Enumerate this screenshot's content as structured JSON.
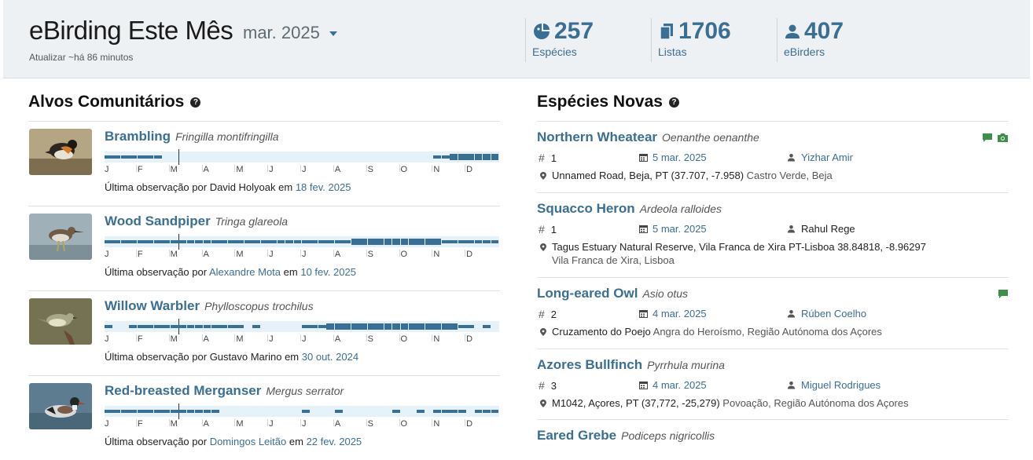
{
  "header": {
    "title": "eBirding Este Mês",
    "month": "mar. 2025",
    "updated": "Atualizar ~há 86 minutos",
    "stats": [
      {
        "value": "257",
        "label": "Espécies",
        "icon": "species-icon"
      },
      {
        "value": "1706",
        "label": "Listas",
        "icon": "checklist-icon"
      },
      {
        "value": "407",
        "label": "eBirders",
        "icon": "person-icon"
      }
    ]
  },
  "targets": {
    "title": "Alvos Comunitários",
    "months": [
      "J",
      "F",
      "M",
      "A",
      "M",
      "J",
      "J",
      "A",
      "S",
      "O",
      "N",
      "D"
    ],
    "items": [
      {
        "name": "Brambling",
        "sci": "Fringilla montifringilla",
        "prefix": "Última observação por",
        "observer": "David Holyoak",
        "observer_link": false,
        "conj": "em",
        "date": "18 fev. 2025",
        "freq": [
          0.3,
          0.3,
          0.35,
          0.2,
          0.25,
          0.2,
          0.3,
          0.0,
          0,
          0,
          0,
          0,
          0,
          0,
          0,
          0,
          0,
          0,
          0,
          0,
          0,
          0,
          0,
          0,
          0,
          0,
          0,
          0,
          0,
          0,
          0,
          0,
          0,
          0,
          0,
          0,
          0,
          0,
          0,
          0,
          0.2,
          0.3,
          0.5,
          0.6,
          0.6,
          0.6,
          0.6,
          0.6
        ]
      },
      {
        "name": "Wood Sandpiper",
        "sci": "Tringa glareola",
        "prefix": "Última observação por",
        "observer": "Alexandre Mota",
        "observer_link": true,
        "conj": "em",
        "date": "10 fev. 2025",
        "freq": [
          0.25,
          0.25,
          0.25,
          0.25,
          0.25,
          0.25,
          0.25,
          0.3,
          0.3,
          0.3,
          0.3,
          0.35,
          0.35,
          0.35,
          0.3,
          0.3,
          0.3,
          0.3,
          0.35,
          0.35,
          0.35,
          0.35,
          0.35,
          0.35,
          0.35,
          0.35,
          0.35,
          0.35,
          0.35,
          0.35,
          0.5,
          0.5,
          0.5,
          0.5,
          0.5,
          0.5,
          0.5,
          0.5,
          0.5,
          0.5,
          0.5,
          0.4,
          0.4,
          0.35,
          0.35,
          0.3,
          0.3,
          0.3
        ]
      },
      {
        "name": "Willow Warbler",
        "sci": "Phylloscopus trochilus",
        "prefix": "Última observação por",
        "observer": "Gustavo Marino",
        "observer_link": false,
        "conj": "em",
        "date": "30 out. 2024",
        "freq": [
          0.2,
          0,
          0,
          0.2,
          0.2,
          0.2,
          0.2,
          0.25,
          0.3,
          0.3,
          0.3,
          0.3,
          0.3,
          0.3,
          0.3,
          0.3,
          0.3,
          0,
          0.3,
          0,
          0,
          0,
          0,
          0,
          0.3,
          0.3,
          0.4,
          0.45,
          0.5,
          0.55,
          0.6,
          0.7,
          0.8,
          0.8,
          0.8,
          0.8,
          0.8,
          0.8,
          0.7,
          0.7,
          0.65,
          0.6,
          0.5,
          0.4,
          0.3,
          0,
          0.2,
          0
        ]
      },
      {
        "name": "Red-breasted Merganser",
        "sci": "Mergus serrator",
        "prefix": "Última observação por",
        "observer": "Domingos Leitão",
        "observer_link": true,
        "conj": "em",
        "date": "22 fev. 2025",
        "freq": [
          0.35,
          0.35,
          0.35,
          0.35,
          0.35,
          0.35,
          0.35,
          0.35,
          0.35,
          0.3,
          0.3,
          0.3,
          0.3,
          0.3,
          0,
          0,
          0,
          0,
          0,
          0,
          0,
          0,
          0,
          0,
          0.3,
          0,
          0,
          0,
          0.3,
          0,
          0,
          0,
          0,
          0,
          0,
          0.3,
          0,
          0,
          0.3,
          0,
          0.3,
          0.3,
          0.35,
          0.35,
          0,
          0.3,
          0.35,
          0.35
        ]
      }
    ]
  },
  "new_species": {
    "title": "Espécies Novas",
    "items": [
      {
        "name": "Northern Wheatear",
        "sci": "Oenanthe oenanthe",
        "num": "1",
        "date": "5 mar. 2025",
        "observer": "Yizhar Amir",
        "observer_link": true,
        "loc": "Unnamed Road, Beja, PT (37.707, -7.958)",
        "loc_sub": "Castro Verde, Beja",
        "loc_line2": "",
        "media": [
          "comment-icon",
          "camera-icon"
        ]
      },
      {
        "name": "Squacco Heron",
        "sci": "Ardeola ralloides",
        "num": "1",
        "date": "5 mar. 2025",
        "observer": "Rahul Rege",
        "observer_link": false,
        "loc": "Tagus Estuary Natural Reserve, Vila Franca de Xira PT-Lisboa 38.84818, -8.96297",
        "loc_sub": "",
        "loc_line2": "Vila Franca de Xira, Lisboa",
        "media": []
      },
      {
        "name": "Long-eared Owl",
        "sci": "Asio otus",
        "num": "2",
        "date": "4 mar. 2025",
        "observer": "Rúben Coelho",
        "observer_link": true,
        "loc": "Cruzamento do Poejo",
        "loc_sub": "Angra do Heroísmo, Região Autónoma dos Açores",
        "loc_line2": "",
        "media": [
          "comment-icon"
        ]
      },
      {
        "name": "Azores Bullfinch",
        "sci": "Pyrrhula murina",
        "num": "3",
        "date": "4 mar. 2025",
        "observer": "Miguel Rodrigues",
        "observer_link": true,
        "loc": "M1042, Açores, PT (37,772, -25,279)",
        "loc_sub": "Povoação, Região Autónoma dos Açores",
        "loc_line2": "",
        "media": []
      },
      {
        "name": "Eared Grebe",
        "sci": "Podiceps nigricollis",
        "num": "",
        "date": "",
        "observer": "",
        "observer_link": false,
        "loc": "",
        "loc_sub": "",
        "loc_line2": "",
        "media": []
      }
    ]
  },
  "colors": {
    "accent": "#3b6e93",
    "media_green": "#3e8f4c",
    "freq_bg": "#e6f2f9"
  }
}
